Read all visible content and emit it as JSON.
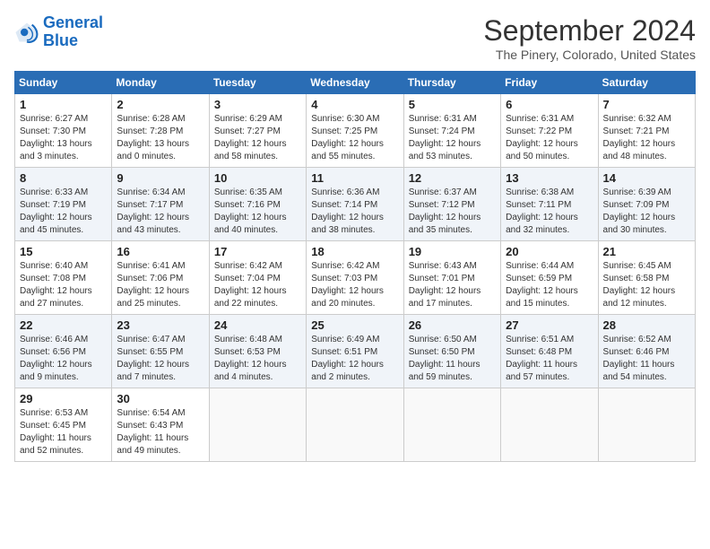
{
  "header": {
    "logo_line1": "General",
    "logo_line2": "Blue",
    "month": "September 2024",
    "location": "The Pinery, Colorado, United States"
  },
  "days_of_week": [
    "Sunday",
    "Monday",
    "Tuesday",
    "Wednesday",
    "Thursday",
    "Friday",
    "Saturday"
  ],
  "weeks": [
    [
      {
        "num": "1",
        "sunrise": "6:27 AM",
        "sunset": "7:30 PM",
        "daylight": "13 hours and 3 minutes."
      },
      {
        "num": "2",
        "sunrise": "6:28 AM",
        "sunset": "7:28 PM",
        "daylight": "13 hours and 0 minutes."
      },
      {
        "num": "3",
        "sunrise": "6:29 AM",
        "sunset": "7:27 PM",
        "daylight": "12 hours and 58 minutes."
      },
      {
        "num": "4",
        "sunrise": "6:30 AM",
        "sunset": "7:25 PM",
        "daylight": "12 hours and 55 minutes."
      },
      {
        "num": "5",
        "sunrise": "6:31 AM",
        "sunset": "7:24 PM",
        "daylight": "12 hours and 53 minutes."
      },
      {
        "num": "6",
        "sunrise": "6:31 AM",
        "sunset": "7:22 PM",
        "daylight": "12 hours and 50 minutes."
      },
      {
        "num": "7",
        "sunrise": "6:32 AM",
        "sunset": "7:21 PM",
        "daylight": "12 hours and 48 minutes."
      }
    ],
    [
      {
        "num": "8",
        "sunrise": "6:33 AM",
        "sunset": "7:19 PM",
        "daylight": "12 hours and 45 minutes."
      },
      {
        "num": "9",
        "sunrise": "6:34 AM",
        "sunset": "7:17 PM",
        "daylight": "12 hours and 43 minutes."
      },
      {
        "num": "10",
        "sunrise": "6:35 AM",
        "sunset": "7:16 PM",
        "daylight": "12 hours and 40 minutes."
      },
      {
        "num": "11",
        "sunrise": "6:36 AM",
        "sunset": "7:14 PM",
        "daylight": "12 hours and 38 minutes."
      },
      {
        "num": "12",
        "sunrise": "6:37 AM",
        "sunset": "7:12 PM",
        "daylight": "12 hours and 35 minutes."
      },
      {
        "num": "13",
        "sunrise": "6:38 AM",
        "sunset": "7:11 PM",
        "daylight": "12 hours and 32 minutes."
      },
      {
        "num": "14",
        "sunrise": "6:39 AM",
        "sunset": "7:09 PM",
        "daylight": "12 hours and 30 minutes."
      }
    ],
    [
      {
        "num": "15",
        "sunrise": "6:40 AM",
        "sunset": "7:08 PM",
        "daylight": "12 hours and 27 minutes."
      },
      {
        "num": "16",
        "sunrise": "6:41 AM",
        "sunset": "7:06 PM",
        "daylight": "12 hours and 25 minutes."
      },
      {
        "num": "17",
        "sunrise": "6:42 AM",
        "sunset": "7:04 PM",
        "daylight": "12 hours and 22 minutes."
      },
      {
        "num": "18",
        "sunrise": "6:42 AM",
        "sunset": "7:03 PM",
        "daylight": "12 hours and 20 minutes."
      },
      {
        "num": "19",
        "sunrise": "6:43 AM",
        "sunset": "7:01 PM",
        "daylight": "12 hours and 17 minutes."
      },
      {
        "num": "20",
        "sunrise": "6:44 AM",
        "sunset": "6:59 PM",
        "daylight": "12 hours and 15 minutes."
      },
      {
        "num": "21",
        "sunrise": "6:45 AM",
        "sunset": "6:58 PM",
        "daylight": "12 hours and 12 minutes."
      }
    ],
    [
      {
        "num": "22",
        "sunrise": "6:46 AM",
        "sunset": "6:56 PM",
        "daylight": "12 hours and 9 minutes."
      },
      {
        "num": "23",
        "sunrise": "6:47 AM",
        "sunset": "6:55 PM",
        "daylight": "12 hours and 7 minutes."
      },
      {
        "num": "24",
        "sunrise": "6:48 AM",
        "sunset": "6:53 PM",
        "daylight": "12 hours and 4 minutes."
      },
      {
        "num": "25",
        "sunrise": "6:49 AM",
        "sunset": "6:51 PM",
        "daylight": "12 hours and 2 minutes."
      },
      {
        "num": "26",
        "sunrise": "6:50 AM",
        "sunset": "6:50 PM",
        "daylight": "11 hours and 59 minutes."
      },
      {
        "num": "27",
        "sunrise": "6:51 AM",
        "sunset": "6:48 PM",
        "daylight": "11 hours and 57 minutes."
      },
      {
        "num": "28",
        "sunrise": "6:52 AM",
        "sunset": "6:46 PM",
        "daylight": "11 hours and 54 minutes."
      }
    ],
    [
      {
        "num": "29",
        "sunrise": "6:53 AM",
        "sunset": "6:45 PM",
        "daylight": "11 hours and 52 minutes."
      },
      {
        "num": "30",
        "sunrise": "6:54 AM",
        "sunset": "6:43 PM",
        "daylight": "11 hours and 49 minutes."
      },
      null,
      null,
      null,
      null,
      null
    ]
  ]
}
